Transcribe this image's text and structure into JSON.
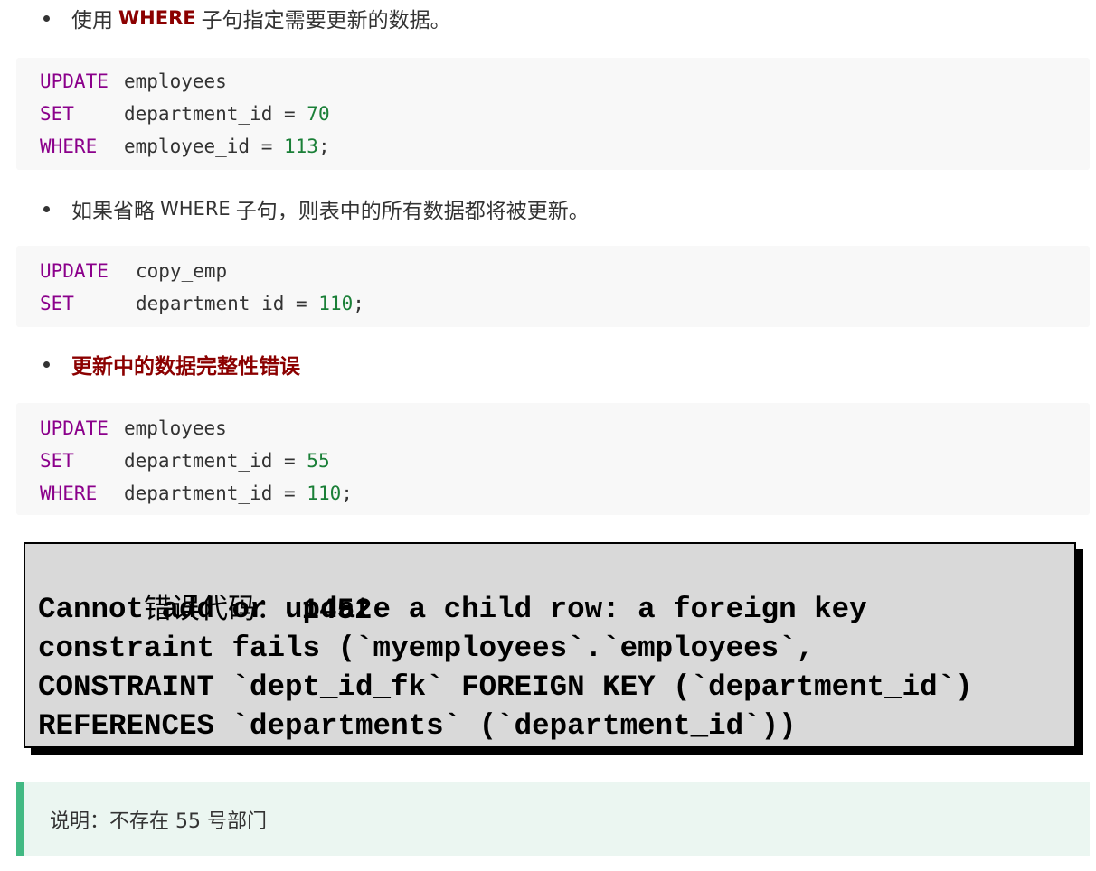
{
  "items": [
    {
      "type": "bullet",
      "pre": "使用",
      "keyword": "WHERE",
      "post": "子句指定需要更新的数据。"
    },
    {
      "type": "code",
      "lines": [
        {
          "kw": "UPDATE",
          "rest": "employees"
        },
        {
          "kw": "SET",
          "rest": "department_id = ",
          "num": "70",
          "end": ""
        },
        {
          "kw": "WHERE",
          "rest": "employee_id = ",
          "num": "113",
          "end": ";"
        }
      ]
    },
    {
      "type": "bullet",
      "pre": "如果省略",
      "keyword": "WHERE",
      "post": "子句，则表中的所有数据都将被更新。"
    },
    {
      "type": "code",
      "lines": [
        {
          "kw": "UPDATE",
          "rest": "copy_emp"
        },
        {
          "kw": "SET",
          "rest": "department_id = ",
          "num": "110",
          "end": ";"
        }
      ]
    },
    {
      "type": "heading",
      "text": "更新中的数据完整性错误"
    },
    {
      "type": "code",
      "lines": [
        {
          "kw": "UPDATE",
          "rest": "employees"
        },
        {
          "kw": "SET",
          "rest": "department_id = ",
          "num": "55",
          "end": ""
        },
        {
          "kw": "WHERE",
          "rest": "department_id = ",
          "num": "110",
          "end": ";"
        }
      ]
    }
  ],
  "error": {
    "label": "错误代码：",
    "code": "1452",
    "lines": [
      "Cannot add or update a child row: a foreign key",
      "constraint fails (`myemployees`.`employees`,",
      "CONSTRAINT `dept_id_fk` FOREIGN KEY (`department_id`)",
      "REFERENCES `departments` (`department_id`))"
    ]
  },
  "note": {
    "text": "说明：不存在 55 号部门"
  }
}
